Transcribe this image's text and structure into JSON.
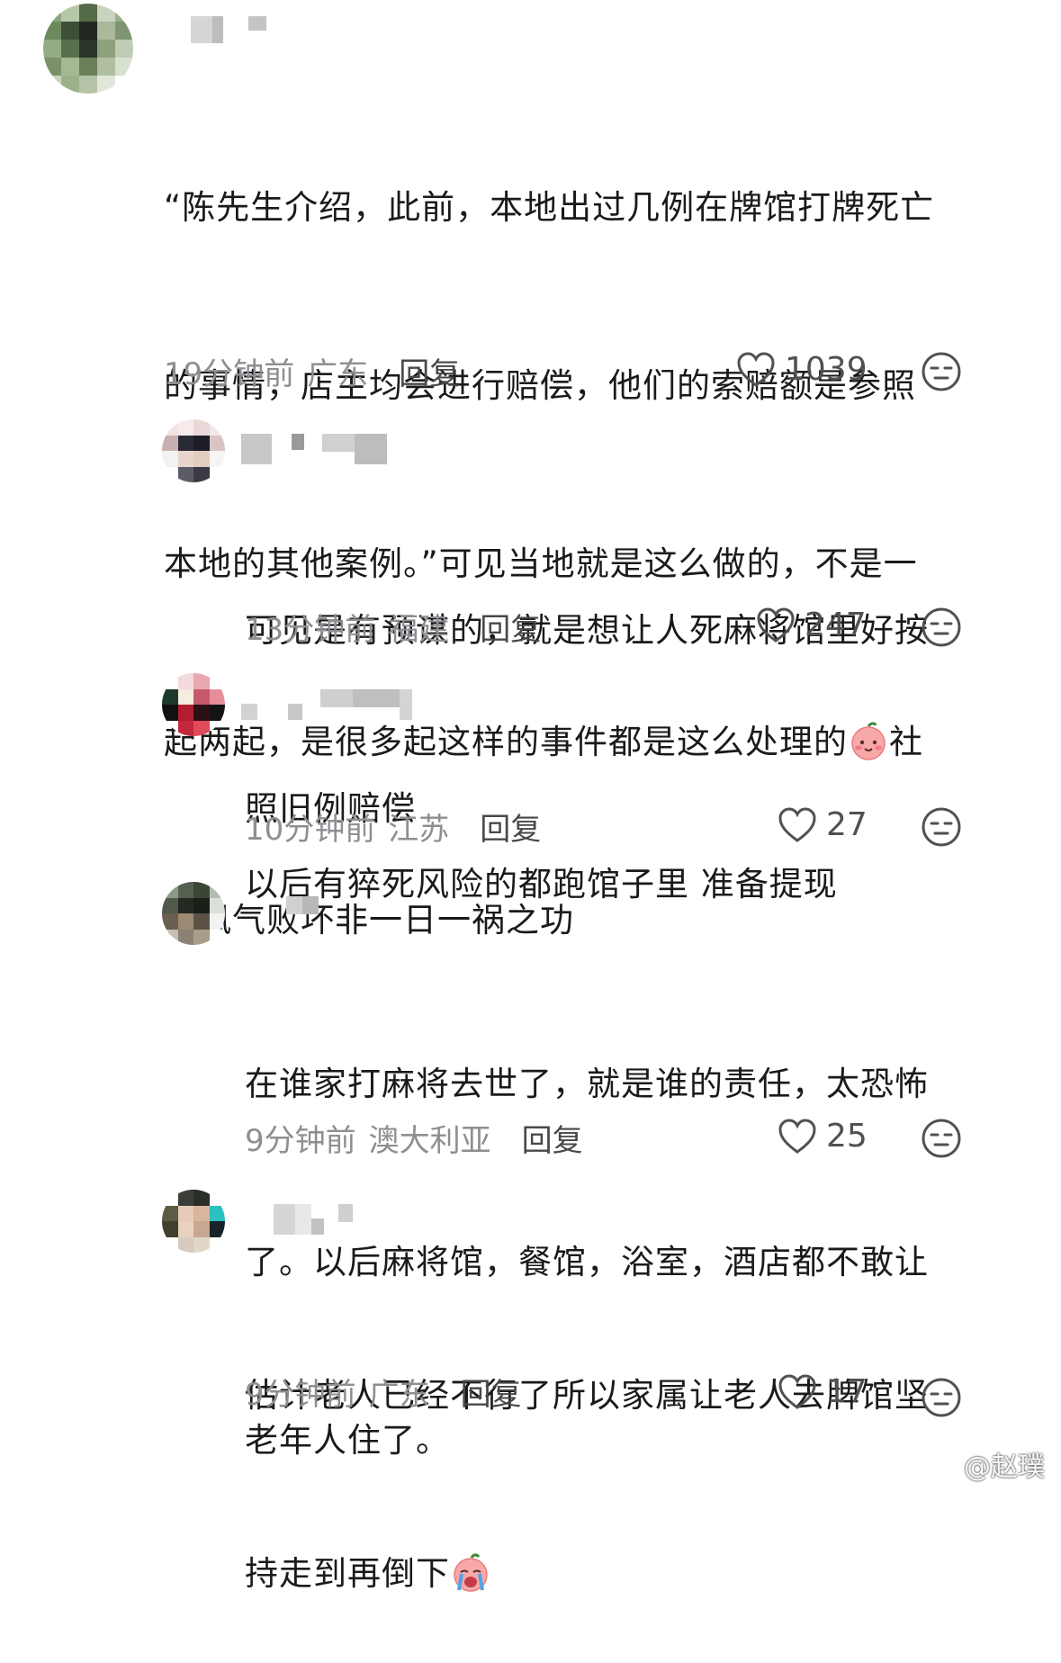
{
  "comments": [
    {
      "text_lines": [
        "“陈先生介绍，此前，本地出过几例在牌馆打牌死亡",
        "的事情，店主均会进行赔偿，他们的索赔额是参照",
        "本地的其他案例。”可见当地就是这么做的，不是一",
        "起两起，是很多起这样的事件都是这么处理的",
        "会风气败坏非一日一祸之功"
      ],
      "line4_suffix": "社",
      "line4_emoji": "blush-face-emoji",
      "time": "19分钟前",
      "location": "广东",
      "reply_label": "回复",
      "likes": "1039"
    },
    {
      "text_lines": [
        "可见是有预谋的，就是想让人死麻将馆里好按",
        "照旧例赔偿"
      ],
      "time": "13分钟前",
      "location": "福建",
      "reply_label": "回复",
      "likes": "247"
    },
    {
      "text_lines": [
        "以后有猝死风险的都跑馆子里 准备提现"
      ],
      "time": "10分钟前",
      "location": "江苏",
      "reply_label": "回复",
      "likes": "27"
    },
    {
      "text_lines": [
        "在谁家打麻将去世了，就是谁的责任，太恐怖",
        "了。以后麻将馆，餐馆，浴室，酒店都不敢让",
        "老年人住了。"
      ],
      "time": "9分钟前",
      "location": "澳大利亚",
      "reply_label": "回复",
      "likes": "25"
    },
    {
      "text_lines": [
        "估计老人已经不行了所以家属让老人去牌馆坚",
        "持走到再倒下"
      ],
      "line_emoji": "crying-face-emoji",
      "time": "9分钟前",
      "location": "广东",
      "reply_label": "回复",
      "likes": "17"
    }
  ],
  "icons": {
    "like": "heart-outline-icon",
    "dislike": "expressionless-face-icon"
  },
  "colors": {
    "meta_text": "#8e8e93",
    "icon_stroke": "#505055"
  },
  "watermark": "@赵璞"
}
